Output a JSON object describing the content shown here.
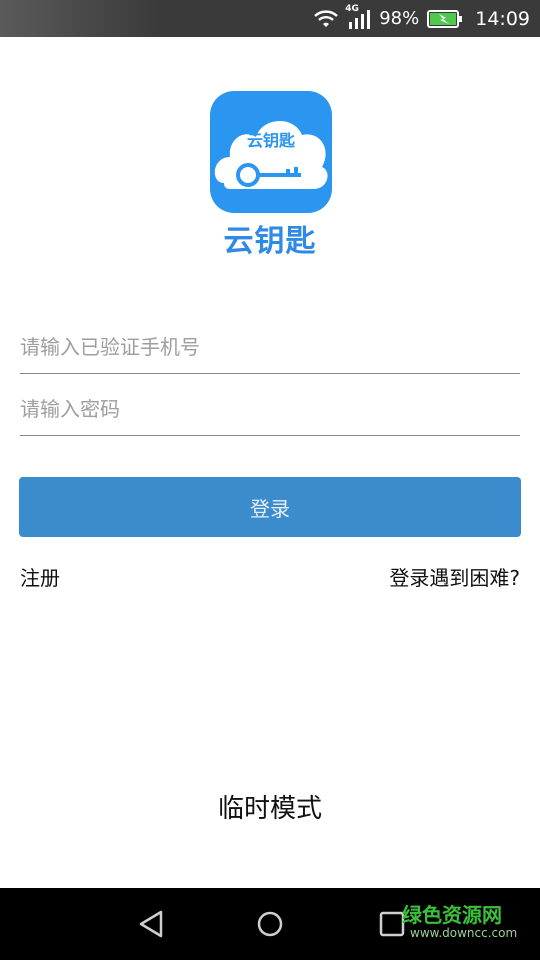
{
  "status_bar": {
    "network": "4G",
    "battery": "98%",
    "time": "14:09",
    "icons": [
      "wifi-icon",
      "signal-icon",
      "battery-charging-icon"
    ]
  },
  "app": {
    "logo_text": "云钥匙",
    "name": "云钥匙",
    "brand_color": "#2b96f0"
  },
  "form": {
    "phone_placeholder": "请输入已验证手机号",
    "password_placeholder": "请输入密码",
    "login_label": "登录",
    "login_color": "#3b8ccd"
  },
  "links": {
    "register": "注册",
    "help": "登录遇到困难?"
  },
  "temp_mode": "临时模式",
  "nav_bar": {
    "icons": [
      "back-icon",
      "home-icon",
      "recent-apps-icon"
    ]
  },
  "watermark": {
    "title": "绿色资源网",
    "url": "www.downcc.com"
  }
}
